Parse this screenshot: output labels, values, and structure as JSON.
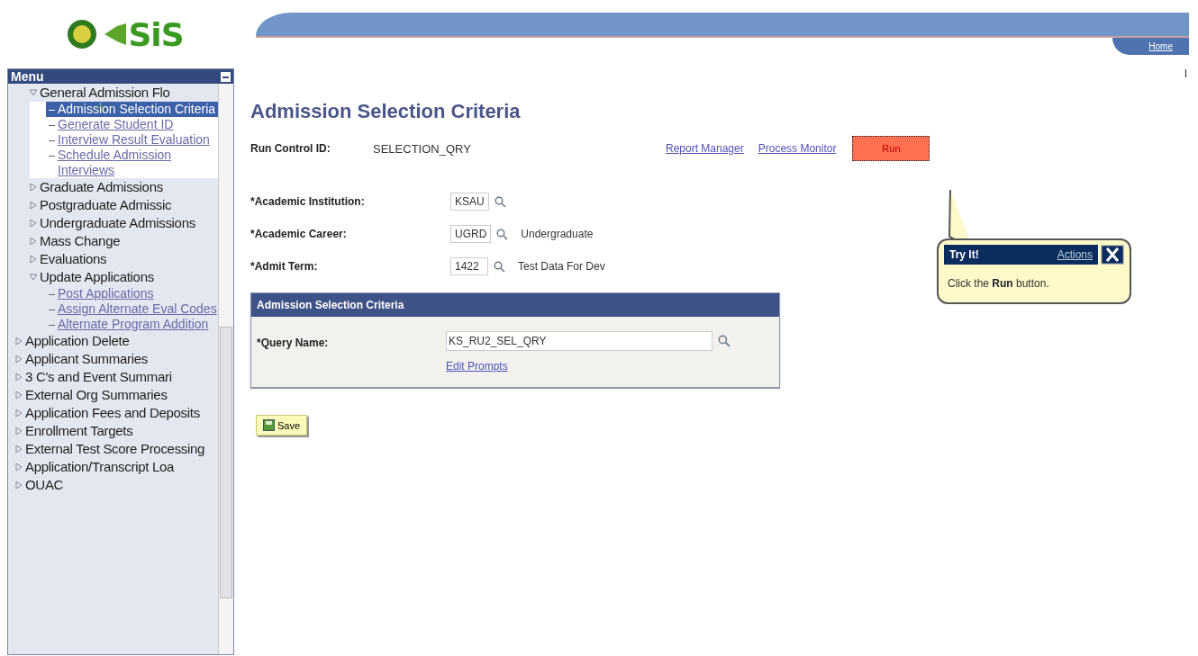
{
  "logo": {
    "text": "SiS"
  },
  "menu": {
    "title": "Menu",
    "nested_items": [
      {
        "label": "General Admission Flo",
        "expanded": true,
        "children": [
          {
            "label": "Admission Selection Criteria",
            "selected": true
          },
          {
            "label": "Generate Student ID",
            "selected": false
          },
          {
            "label": "Interview Result Evaluation",
            "selected": false
          },
          {
            "label": "Schedule Admission Interviews",
            "selected": false
          }
        ]
      },
      {
        "label": "Graduate Admissions",
        "expanded": false
      },
      {
        "label": "Postgraduate Admissic",
        "expanded": false
      },
      {
        "label": "Undergraduate Admissions",
        "expanded": false
      },
      {
        "label": "Mass Change",
        "expanded": false
      },
      {
        "label": "Evaluations",
        "expanded": false
      },
      {
        "label": "Update Applications",
        "expanded": true,
        "children": [
          {
            "label": "Post Applications",
            "selected": false
          },
          {
            "label": "Assign Alternate Eval Codes",
            "selected": false
          },
          {
            "label": "Alternate Program Addition",
            "selected": false
          }
        ]
      }
    ],
    "items": [
      {
        "label": "Application Delete",
        "expanded": false
      },
      {
        "label": "Applicant Summaries",
        "expanded": false
      },
      {
        "label": "3 C's and Event Summari",
        "expanded": false
      },
      {
        "label": "External Org Summaries",
        "expanded": false
      },
      {
        "label": "Application Fees and Deposits",
        "expanded": false
      },
      {
        "label": "Enrollment Targets",
        "expanded": false
      },
      {
        "label": "External Test Score Processing",
        "expanded": false
      },
      {
        "label": "Application/Transcript Loa",
        "expanded": false
      },
      {
        "label": "OUAC",
        "expanded": false
      }
    ]
  },
  "header": {
    "home_link": "Home",
    "marker": "I"
  },
  "page": {
    "title": "Admission Selection Criteria",
    "run_control": {
      "label": "Run Control ID:",
      "value": "SELECTION_QRY"
    },
    "links": [
      "Report Manager",
      "Process Monitor"
    ],
    "run_button": "Run",
    "fields": [
      {
        "label": "*Academic Institution:",
        "value": "KSAU"
      },
      {
        "label": "*Academic Career:",
        "value": "UGRD",
        "description": "Undergraduate"
      },
      {
        "label": "*Admit Term:",
        "value": "1422",
        "description": "Test Data For Dev"
      }
    ],
    "group": {
      "title": "Admission Selection Criteria",
      "query_label": "*Query Name:",
      "query_value": "KS_RU2_SEL_QRY",
      "edit_link": "Edit Prompts"
    },
    "save_button": "Save"
  },
  "callout": {
    "title": "Try It!",
    "actions": "Actions",
    "message": "Click the **Run** button."
  }
}
